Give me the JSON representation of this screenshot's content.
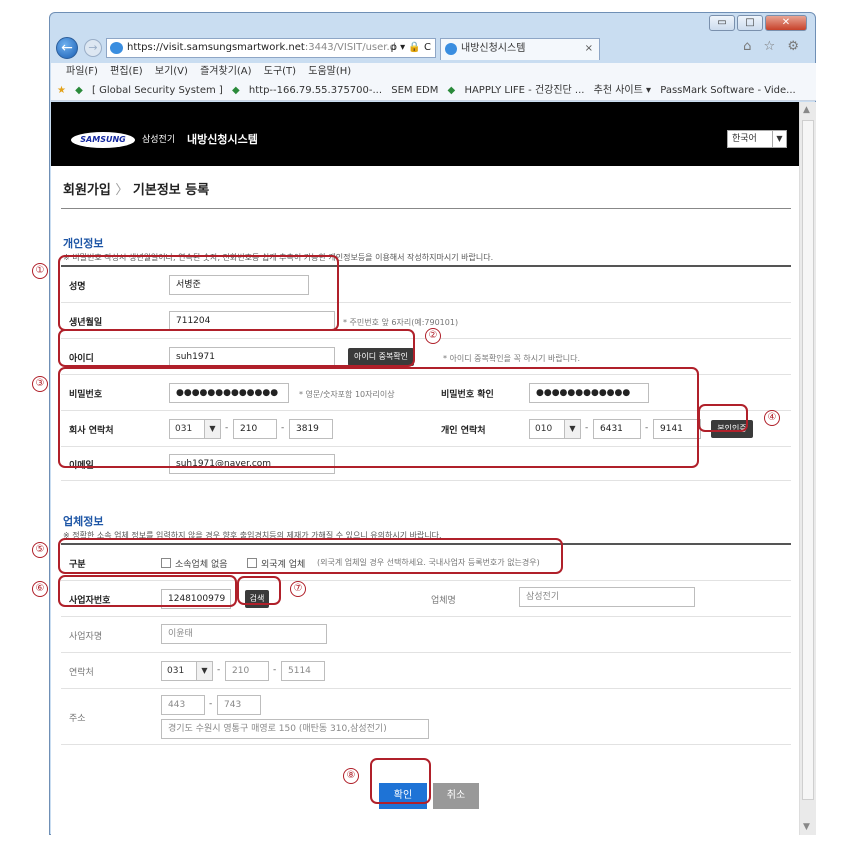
{
  "browser": {
    "url_main": "https://visit.samsungsmartwork.net",
    "url_rest": ":3443/VISIT/user.d",
    "url_icons": "ρ ▾ 🔒 C",
    "tab_title": "내방신청시스템",
    "tab_close": "×",
    "window_controls": [
      "▭",
      "□",
      "✕"
    ],
    "menu": [
      "파일(F)",
      "편집(E)",
      "보기(V)",
      "즐겨찾기(A)",
      "도구(T)",
      "도움말(H)"
    ],
    "favorites": [
      "[ Global Security System ]",
      "http--166.79.55.375700-...",
      "SEM EDM",
      "HAPPLY LIFE - 건강진단 ...",
      "추천 사이트 ▾",
      "PassMark Software - Vide..."
    ],
    "toolbar_icons": "⌂ ☆ ⚙"
  },
  "header": {
    "logo": "SAMSUNG",
    "brand": "삼성전기",
    "system_title": "내방신청시스템",
    "language": "한국어"
  },
  "breadcrumb": {
    "part1": "회원가입",
    "sep": "〉",
    "part2": "기본정보 등록"
  },
  "personal": {
    "title": "개인정보",
    "notice": "※ 비밀번호 작성시 생년월일이나, 연속된 숫자, 전화번호등 쉽게 추측이 가능한 개인정보등을 이용해서 작성하지마시기 바랍니다.",
    "name_label": "성명",
    "name_value": "서병준",
    "birth_label": "생년월일",
    "birth_value": "711204",
    "birth_hint": "* 주민번호 앞 6자리(예:790101)",
    "id_label": "아이디",
    "id_value": "suh1971",
    "id_check_button": "아이디 중복확인",
    "id_hint": "* 아이디 중복확인을 꼭 하시기 바랍니다.",
    "pw_label": "비밀번호",
    "pw_value": "●●●●●●●●●●●●●",
    "pw_hint": "* 영문/숫자포함 10자리이상",
    "pw_confirm_label": "비밀번호 확인",
    "pw_confirm_value": "●●●●●●●●●●●●",
    "company_phone_label": "회사 연락처",
    "company_phone": [
      "031",
      "210",
      "3819"
    ],
    "mobile_label": "개인 연락처",
    "mobile": [
      "010",
      "6431",
      "9141"
    ],
    "verify_button": "본인인증",
    "email_label": "이메일",
    "email_value": "suh1971@naver.com",
    "dash": "-"
  },
  "company": {
    "title": "업체정보",
    "notice": "※ 정확한 소속 업체 정보를 입력하지 않을 경우 향후 출입경치등의 제재가 가해질 수 있으니 유의하시기 바랍니다.",
    "type_label": "구분",
    "opt_no_company": "소속업체 없음",
    "opt_foreign": "외국계 업체",
    "opt_foreign_note": "(외국계 업체일 경우 선택하세요. 국내사업자 등록번호가 없는경우)",
    "bizno_label": "사업자번호",
    "bizno_value": "1248100979",
    "search_button": "검색",
    "company_name_label": "업체명",
    "company_name_value": "삼성전기",
    "ceo_label": "사업자명",
    "ceo_value": "이윤태",
    "contact_label": "연락처",
    "contact": [
      "031",
      "210",
      "5114"
    ],
    "address_label": "주소",
    "zip": [
      "443",
      "743"
    ],
    "address_value": "경기도 수원시 영통구 매영로 150 (매탄동 310,삼성전기)"
  },
  "actions": {
    "confirm": "확인",
    "cancel": "취소"
  },
  "callouts": [
    "①",
    "②",
    "③",
    "④",
    "⑤",
    "⑥",
    "⑦",
    "⑧"
  ],
  "colors": {
    "callout": "#b0202a",
    "primary": "#1e73d6",
    "section": "#1e56a6"
  }
}
